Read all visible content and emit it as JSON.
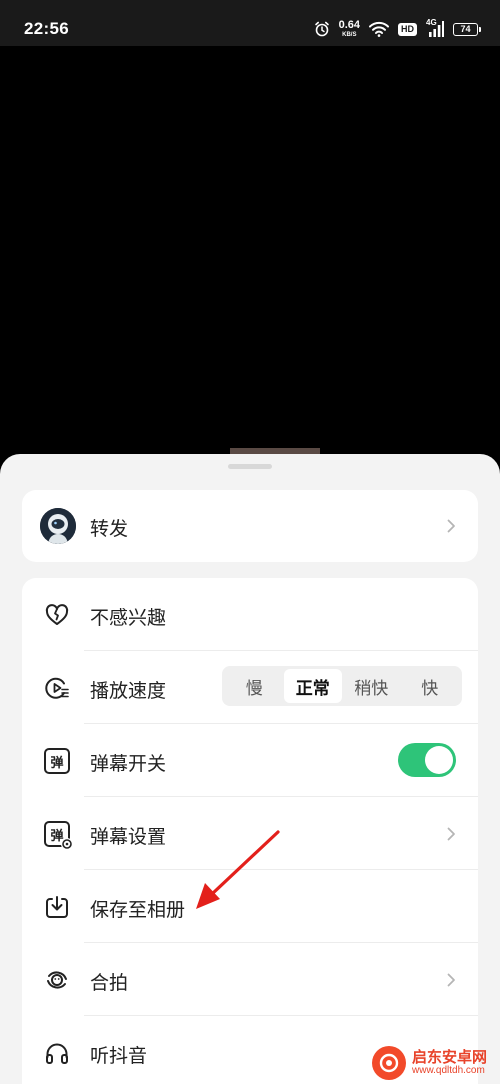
{
  "status_bar": {
    "time": "22:56",
    "net_speed_value": "0.64",
    "net_speed_unit": "KB/S",
    "hd_badge": "HD",
    "network_type": "4G",
    "battery_level": "74",
    "icons": [
      "alarm-icon",
      "wifi-icon",
      "hd-icon",
      "cellular-signal-icon",
      "battery-icon"
    ]
  },
  "share": {
    "label": "转发"
  },
  "menu": {
    "not_interested_label": "不感兴趣",
    "playback_speed_label": "播放速度",
    "speed_options": [
      "慢",
      "正常",
      "稍快",
      "快"
    ],
    "speed_selected": "正常",
    "danmaku_toggle_label": "弹幕开关",
    "danmaku_toggle_on": true,
    "danmaku_icon_glyph": "弹",
    "danmaku_settings_label": "弹幕设置",
    "save_to_album_label": "保存至相册",
    "duet_label": "合拍",
    "listen_douyin_label": "听抖音"
  },
  "colors": {
    "toggle_on": "#2ec479",
    "annotation_arrow": "#e3201b",
    "sheet_bg": "#f3f3f3",
    "card_bg": "#ffffff"
  },
  "watermark": {
    "name": "启东安卓网",
    "url": "www.qdltdh.com"
  }
}
